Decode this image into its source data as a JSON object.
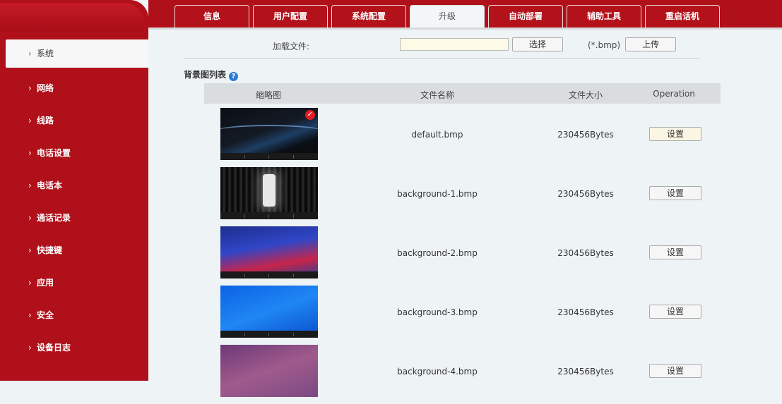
{
  "sidebar": {
    "items": [
      {
        "label": "系统",
        "active": true
      },
      {
        "label": "网络"
      },
      {
        "label": "线路"
      },
      {
        "label": "电话设置"
      },
      {
        "label": "电话本"
      },
      {
        "label": "通话记录"
      },
      {
        "label": "快捷键"
      },
      {
        "label": "应用"
      },
      {
        "label": "安全"
      },
      {
        "label": "设备日志"
      }
    ],
    "chevron": "›"
  },
  "tabs": [
    {
      "label": "信息"
    },
    {
      "label": "用户配置"
    },
    {
      "label": "系统配置"
    },
    {
      "label": "升级",
      "active": true
    },
    {
      "label": "自动部署"
    },
    {
      "label": "辅助工具"
    },
    {
      "label": "重启话机"
    }
  ],
  "upload": {
    "label": "加载文件:",
    "file_value": "",
    "select_button": "选择",
    "hint": "(*.bmp)",
    "upload_button": "上传"
  },
  "section": {
    "title": "背景图列表",
    "help_icon": "question-circle-icon"
  },
  "table": {
    "headers": [
      "缩略图",
      "文件名称",
      "文件大小",
      "Operation"
    ],
    "rows": [
      {
        "name": "default.bmp",
        "size": "230456Bytes",
        "action": "设置",
        "selected": true
      },
      {
        "name": "background-1.bmp",
        "size": "230456Bytes",
        "action": "设置"
      },
      {
        "name": "background-2.bmp",
        "size": "230456Bytes",
        "action": "设置"
      },
      {
        "name": "background-3.bmp",
        "size": "230456Bytes",
        "action": "设置"
      },
      {
        "name": "background-4.bmp",
        "size": "230456Bytes",
        "action": "设置"
      }
    ]
  },
  "colors": {
    "brand_red": "#b0101a",
    "page_bg": "#eef4f6",
    "check_red": "#e31b23",
    "help_blue": "#2b7bd3"
  }
}
